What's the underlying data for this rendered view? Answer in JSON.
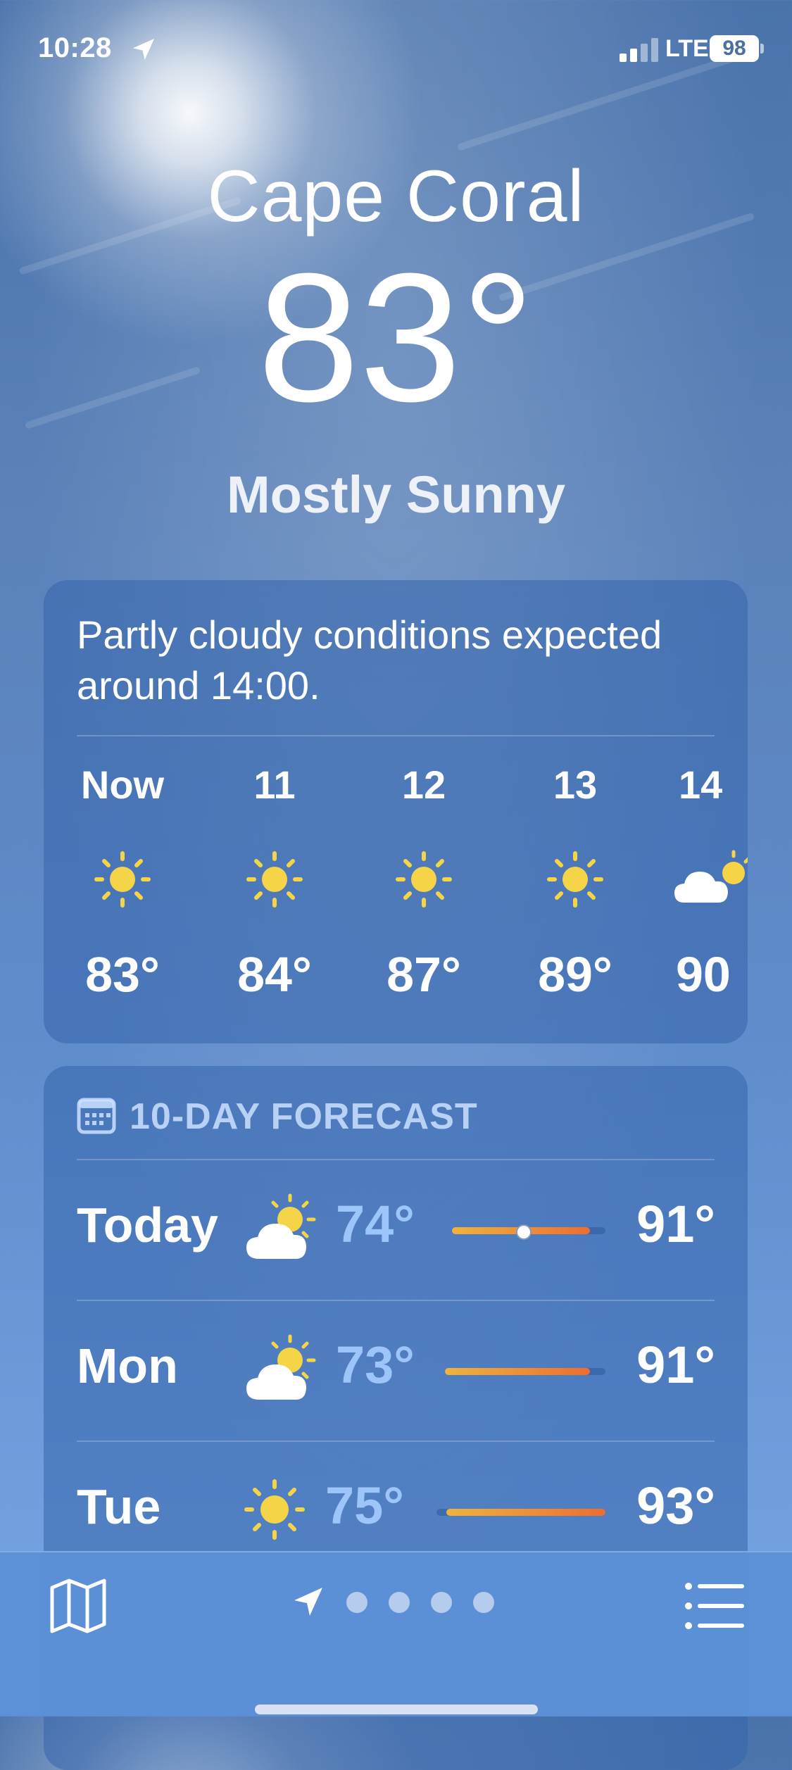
{
  "status_bar": {
    "time": "10:28",
    "network": "LTE",
    "battery": "98"
  },
  "header": {
    "city": "Cape Coral",
    "temperature": "83°",
    "condition": "Mostly Sunny"
  },
  "hourly": {
    "summary": "Partly cloudy conditions expected around 14:00.",
    "hours": [
      {
        "label": "Now",
        "icon": "sun-icon",
        "temp": "83°"
      },
      {
        "label": "11",
        "icon": "sun-icon",
        "temp": "84°"
      },
      {
        "label": "12",
        "icon": "sun-icon",
        "temp": "87°"
      },
      {
        "label": "13",
        "icon": "sun-icon",
        "temp": "89°"
      },
      {
        "label": "14",
        "icon": "partly-cloudy-icon",
        "temp": "90"
      }
    ]
  },
  "forecast": {
    "title": "10-DAY FORECAST",
    "days": [
      {
        "day": "Today",
        "icon": "partly-cloudy-icon",
        "low": "74°",
        "high": "91°",
        "current_position": 0.5
      },
      {
        "day": "Mon",
        "icon": "partly-cloudy-icon",
        "low": "73°",
        "high": "91°"
      },
      {
        "day": "Tue",
        "icon": "sun-icon",
        "low": "75°",
        "high": "93°"
      }
    ]
  },
  "toolbar": {
    "page_count": 4,
    "current_page": "location"
  },
  "colors": {
    "sun": "#f5d547",
    "bar_start": "#f0b33c",
    "bar_end": "#ef6d2f",
    "low_temp": "#a5cdff"
  }
}
